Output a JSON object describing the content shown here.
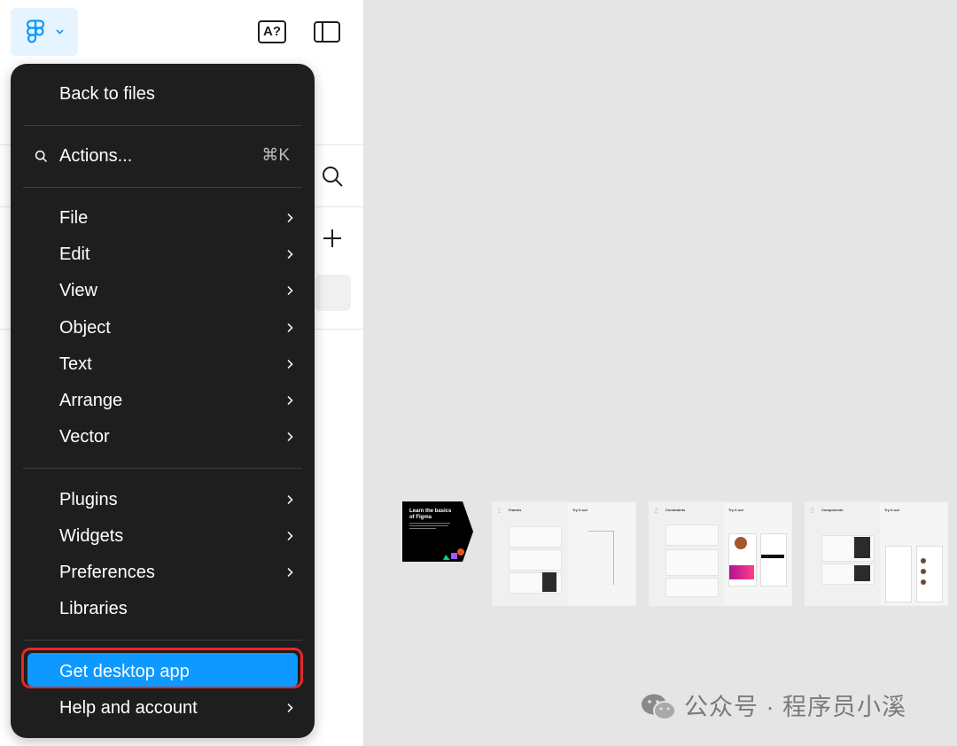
{
  "menu": {
    "items": [
      {
        "label": "Back to files",
        "submenu": false
      },
      {
        "label": "Actions...",
        "shortcut": "⌘K",
        "icon": "search-icon"
      },
      {
        "label": "File",
        "submenu": true
      },
      {
        "label": "Edit",
        "submenu": true
      },
      {
        "label": "View",
        "submenu": true
      },
      {
        "label": "Object",
        "submenu": true
      },
      {
        "label": "Text",
        "submenu": true
      },
      {
        "label": "Arrange",
        "submenu": true
      },
      {
        "label": "Vector",
        "submenu": true
      },
      {
        "label": "Plugins",
        "submenu": true
      },
      {
        "label": "Widgets",
        "submenu": true
      },
      {
        "label": "Preferences",
        "submenu": true
      },
      {
        "label": "Libraries",
        "submenu": false
      },
      {
        "label": "Get desktop app",
        "submenu": false,
        "highlighted": true
      },
      {
        "label": "Help and account",
        "submenu": true
      }
    ]
  },
  "toolbar": {
    "logo_icon": "figma-logo-icon",
    "font_icon_label": "A?",
    "sidebar_icon": "sidebar-toggle-icon"
  },
  "canvas": {
    "cover": {
      "title": "Learn the basics of Figma"
    },
    "cards": [
      {
        "number": "1",
        "title": "Frames",
        "side_title": "Try it out"
      },
      {
        "number": "2",
        "title": "Constraints",
        "side_title": "Try it out"
      },
      {
        "number": "3",
        "title": "Components",
        "side_title": "Try it out"
      }
    ]
  },
  "watermark": {
    "text": "公众号 · 程序员小溪"
  },
  "colors": {
    "menu_bg": "#1e1e1e",
    "highlight": "#0d99ff",
    "highlight_outline": "#e8262a",
    "logo_btn_bg": "#e5f4ff",
    "canvas_bg": "#e5e5e5"
  }
}
